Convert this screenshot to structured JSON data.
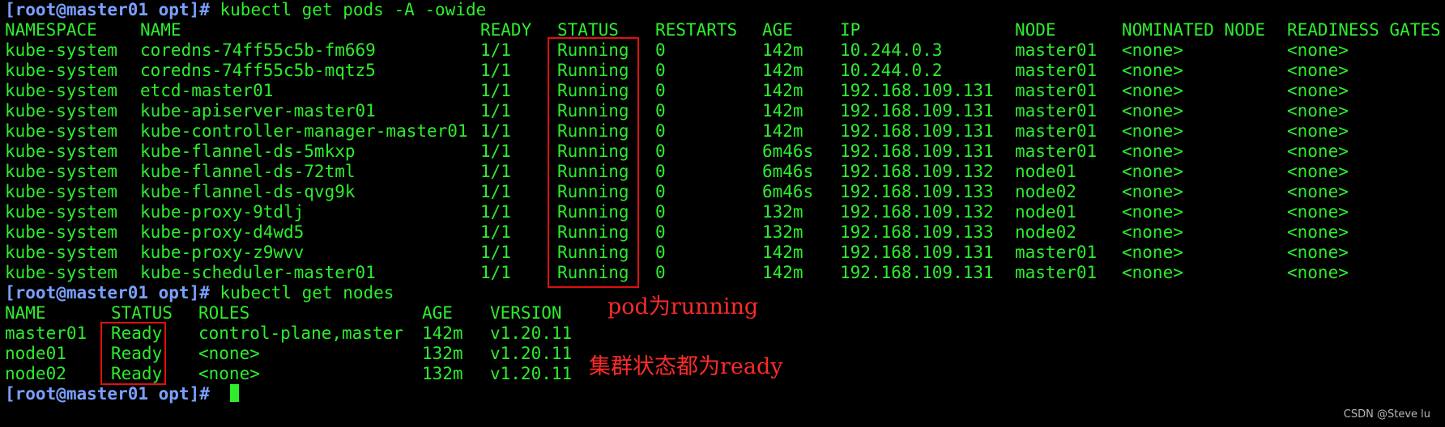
{
  "colors": {
    "background": "#000000",
    "text": "#2ded2d",
    "prompt": "#7aa0ff",
    "highlight_box": "#e01010",
    "annotation": "#ff2a2a"
  },
  "prompt": "[root@master01 opt]#",
  "commands": {
    "get_pods": "kubectl get pods -A -owide",
    "get_nodes": "kubectl get nodes",
    "current": ""
  },
  "pods": {
    "headers": [
      "NAMESPACE",
      "NAME",
      "READY",
      "STATUS",
      "RESTARTS",
      "AGE",
      "IP",
      "NODE",
      "NOMINATED NODE",
      "READINESS GATES"
    ],
    "rows": [
      [
        "kube-system",
        "coredns-74ff55c5b-fm669",
        "1/1",
        "Running",
        "0",
        "142m",
        "10.244.0.3",
        "master01",
        "<none>",
        "<none>"
      ],
      [
        "kube-system",
        "coredns-74ff55c5b-mqtz5",
        "1/1",
        "Running",
        "0",
        "142m",
        "10.244.0.2",
        "master01",
        "<none>",
        "<none>"
      ],
      [
        "kube-system",
        "etcd-master01",
        "1/1",
        "Running",
        "0",
        "142m",
        "192.168.109.131",
        "master01",
        "<none>",
        "<none>"
      ],
      [
        "kube-system",
        "kube-apiserver-master01",
        "1/1",
        "Running",
        "0",
        "142m",
        "192.168.109.131",
        "master01",
        "<none>",
        "<none>"
      ],
      [
        "kube-system",
        "kube-controller-manager-master01",
        "1/1",
        "Running",
        "0",
        "142m",
        "192.168.109.131",
        "master01",
        "<none>",
        "<none>"
      ],
      [
        "kube-system",
        "kube-flannel-ds-5mkxp",
        "1/1",
        "Running",
        "0",
        "6m46s",
        "192.168.109.131",
        "master01",
        "<none>",
        "<none>"
      ],
      [
        "kube-system",
        "kube-flannel-ds-72tml",
        "1/1",
        "Running",
        "0",
        "6m46s",
        "192.168.109.132",
        "node01",
        "<none>",
        "<none>"
      ],
      [
        "kube-system",
        "kube-flannel-ds-qvg9k",
        "1/1",
        "Running",
        "0",
        "6m46s",
        "192.168.109.133",
        "node02",
        "<none>",
        "<none>"
      ],
      [
        "kube-system",
        "kube-proxy-9tdlj",
        "1/1",
        "Running",
        "0",
        "132m",
        "192.168.109.132",
        "node01",
        "<none>",
        "<none>"
      ],
      [
        "kube-system",
        "kube-proxy-d4wd5",
        "1/1",
        "Running",
        "0",
        "132m",
        "192.168.109.133",
        "node02",
        "<none>",
        "<none>"
      ],
      [
        "kube-system",
        "kube-proxy-z9wvv",
        "1/1",
        "Running",
        "0",
        "142m",
        "192.168.109.131",
        "master01",
        "<none>",
        "<none>"
      ],
      [
        "kube-system",
        "kube-scheduler-master01",
        "1/1",
        "Running",
        "0",
        "142m",
        "192.168.109.131",
        "master01",
        "<none>",
        "<none>"
      ]
    ]
  },
  "nodes": {
    "headers": [
      "NAME",
      "STATUS",
      "ROLES",
      "AGE",
      "VERSION"
    ],
    "rows": [
      [
        "master01",
        "Ready",
        "control-plane,master",
        "142m",
        "v1.20.11"
      ],
      [
        "node01",
        "Ready",
        "<none>",
        "132m",
        "v1.20.11"
      ],
      [
        "node02",
        "Ready",
        "<none>",
        "132m",
        "v1.20.11"
      ]
    ]
  },
  "annotations": {
    "pods": "pod为running",
    "nodes": "集群状态都为ready"
  },
  "watermark": "CSDN @Steve lu"
}
